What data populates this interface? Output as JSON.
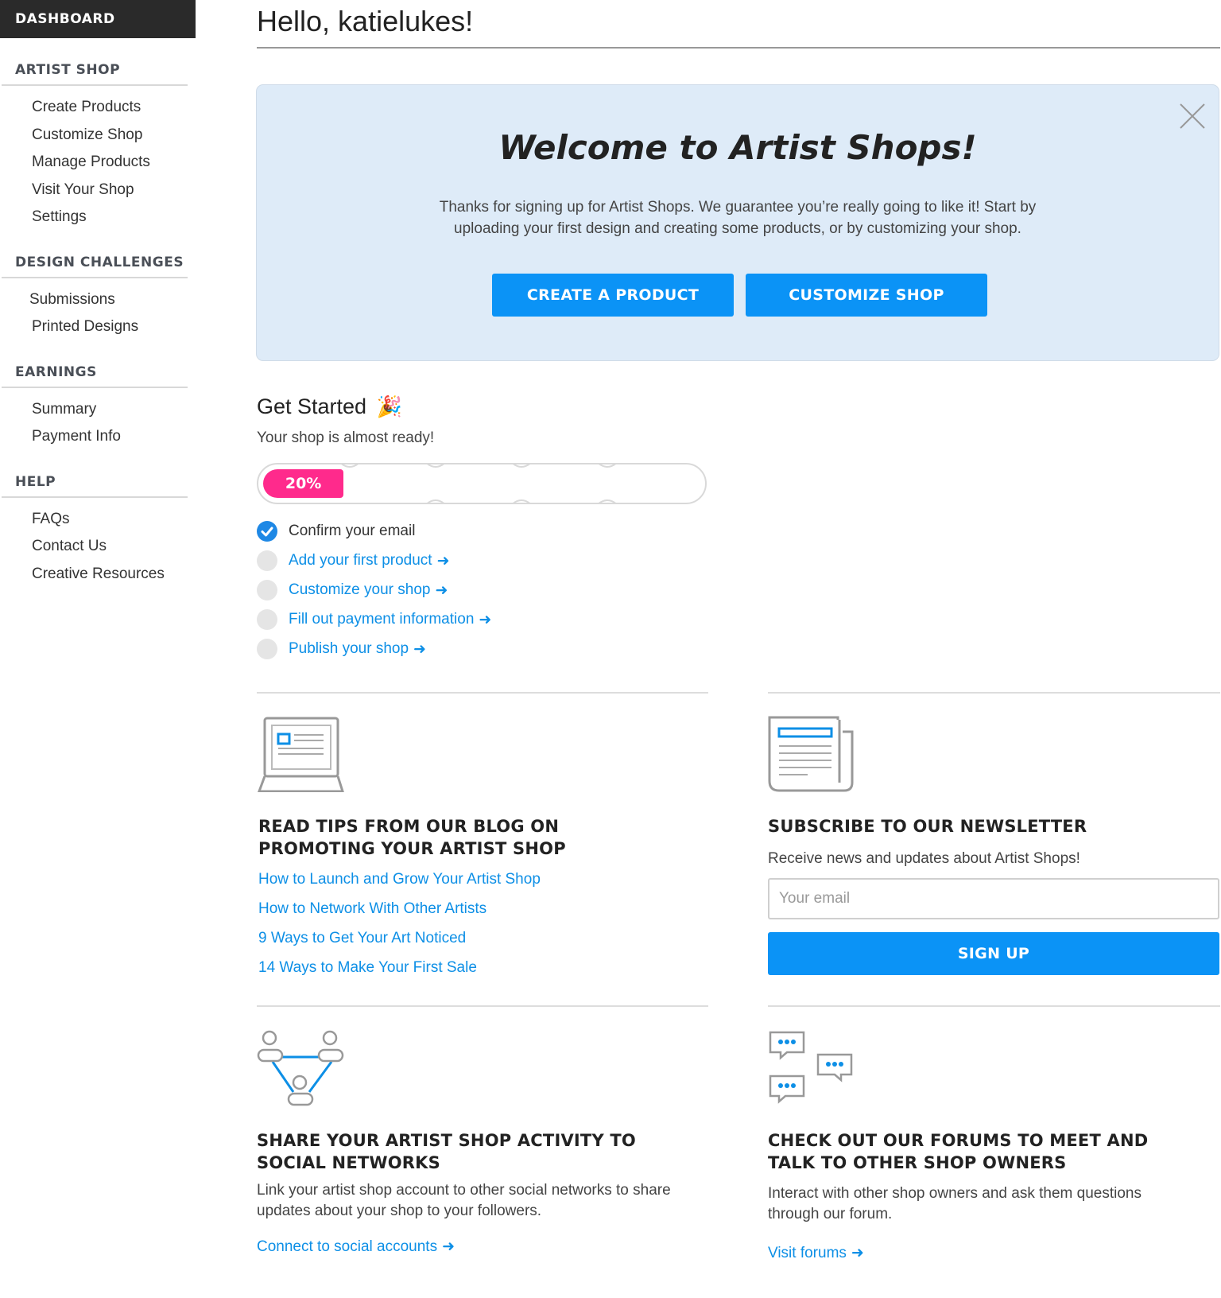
{
  "sidebar": {
    "header": "DASHBOARD",
    "sections": [
      {
        "title": "ARTIST SHOP",
        "items": [
          "Create Products",
          "Customize Shop",
          "Manage Products",
          "Visit Your Shop",
          "Settings"
        ]
      },
      {
        "title": "DESIGN CHALLENGES",
        "items": [
          "Submissions",
          "Printed Designs"
        ]
      },
      {
        "title": "EARNINGS",
        "items": [
          "Summary",
          "Payment Info"
        ]
      },
      {
        "title": "HELP",
        "items": [
          "FAQs",
          "Contact Us",
          "Creative Resources"
        ]
      }
    ]
  },
  "main": {
    "greeting": "Hello, katielukes!",
    "welcome": {
      "title": "Welcome to Artist Shops!",
      "text": "Thanks for signing up for Artist Shops. We guarantee you’re really going to like it! Start by uploading your first design and creating some products, or by customizing your shop.",
      "create_button": "CREATE A PRODUCT",
      "customize_button": "CUSTOMIZE SHOP",
      "close_icon": "close-icon"
    },
    "get_started": {
      "title": "Get Started",
      "emoji": "🎉",
      "subtitle": "Your shop is almost ready!",
      "progress_label": "20%",
      "progress_fraction": 0.2,
      "steps": [
        {
          "label": "Confirm your email",
          "done": true
        },
        {
          "label": "Add your first product",
          "done": false
        },
        {
          "label": "Customize your shop",
          "done": false
        },
        {
          "label": "Fill out payment information",
          "done": false
        },
        {
          "label": "Publish your shop",
          "done": false
        }
      ],
      "arrow": "➜"
    },
    "blog": {
      "icon": "laptop-icon",
      "title_line1": "READ TIPS FROM OUR BLOG ON",
      "title_line2": "PROMOTING YOUR ARTIST SHOP",
      "links": [
        "How to Launch and Grow Your Artist Shop",
        "How to Network With Other Artists",
        "9 Ways to Get Your Art Noticed",
        "14 Ways to Make Your First Sale"
      ]
    },
    "newsletter": {
      "icon": "newspaper-icon",
      "title": "SUBSCRIBE TO OUR NEWSLETTER",
      "text": "Receive news and updates about Artist Shops!",
      "placeholder": "Your email",
      "button": "SIGN UP"
    },
    "social": {
      "icon": "network-icon",
      "title_line1": "SHARE YOUR ARTIST SHOP ACTIVITY TO",
      "title_line2": "SOCIAL NETWORKS",
      "text": "Link your artist shop account to other social networks to share updates about your shop to your followers.",
      "link": "Connect to social accounts"
    },
    "forums": {
      "icon": "chat-bubbles-icon",
      "title_line1": "CHECK OUT OUR FORUMS TO MEET AND",
      "title_line2": "TALK TO OTHER SHOP OWNERS",
      "text": "Interact with other shop owners and ask them questions through our forum.",
      "link": "Visit forums"
    }
  },
  "colors": {
    "accent": "#0b93f6",
    "progress": "#ff2a8c",
    "banner": "#deebf8",
    "sidebar_header": "#2a2a2a"
  }
}
